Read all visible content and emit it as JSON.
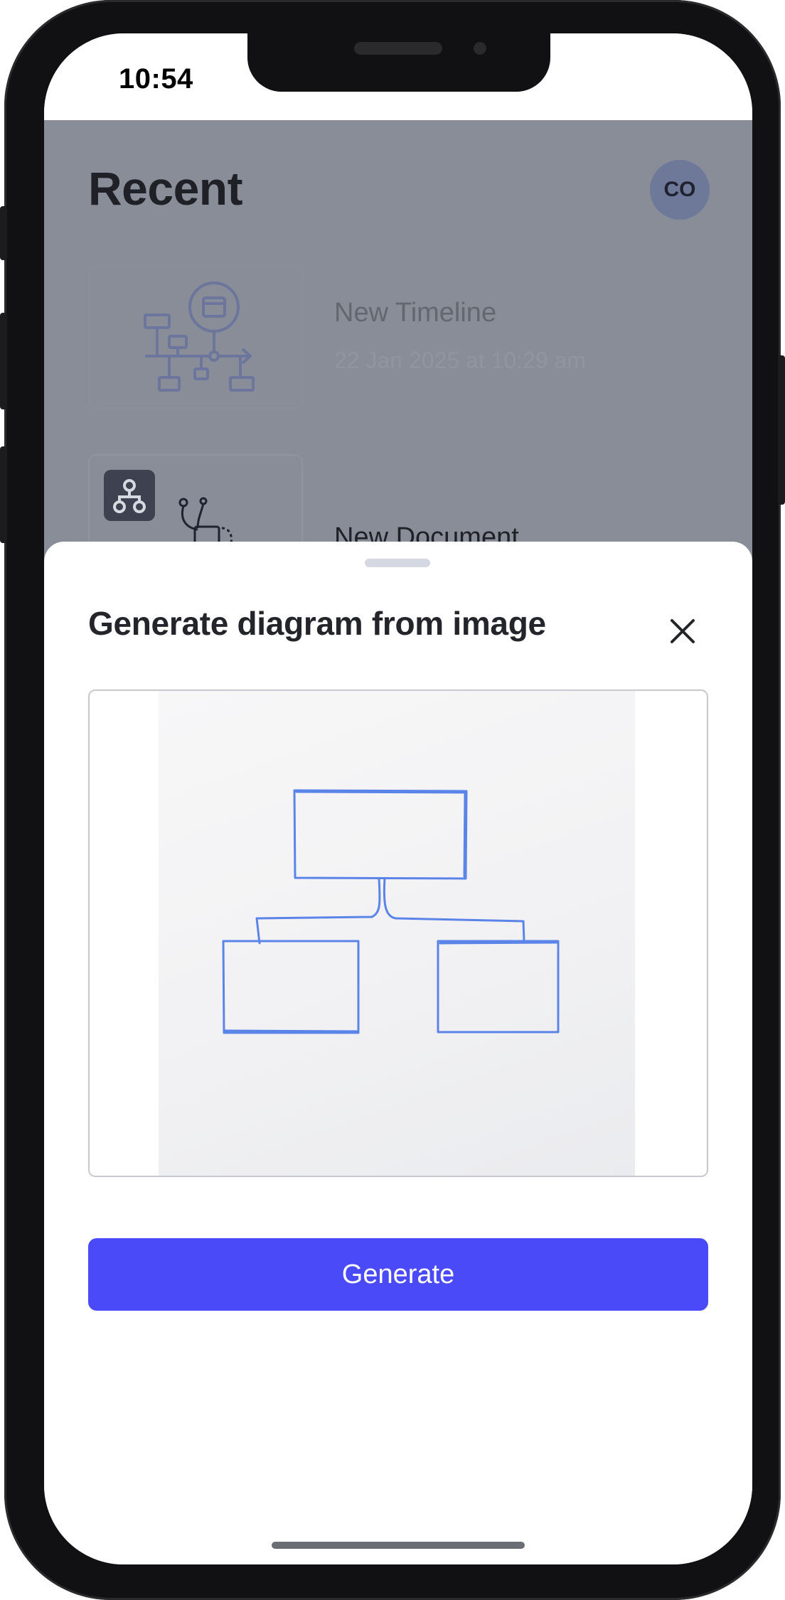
{
  "status_bar": {
    "time": "10:54"
  },
  "header": {
    "title": "Recent",
    "avatar_initials": "CO"
  },
  "recent_items": [
    {
      "name": "New Timeline",
      "date": "22 Jan 2025 at 10:29 am",
      "thumbnail_icon": "timeline-diagram-icon"
    },
    {
      "name": "New Document",
      "thumbnail_icon": "org-chart-icon"
    }
  ],
  "sheet": {
    "title": "Generate diagram from image",
    "close_icon": "close-icon",
    "image_content": "hand-drawn-hierarchy-sketch",
    "generate_label": "Generate"
  },
  "colors": {
    "accent": "#4a4af9",
    "overlay_bg": "#888d98",
    "sketch_stroke": "#5b84e8"
  }
}
